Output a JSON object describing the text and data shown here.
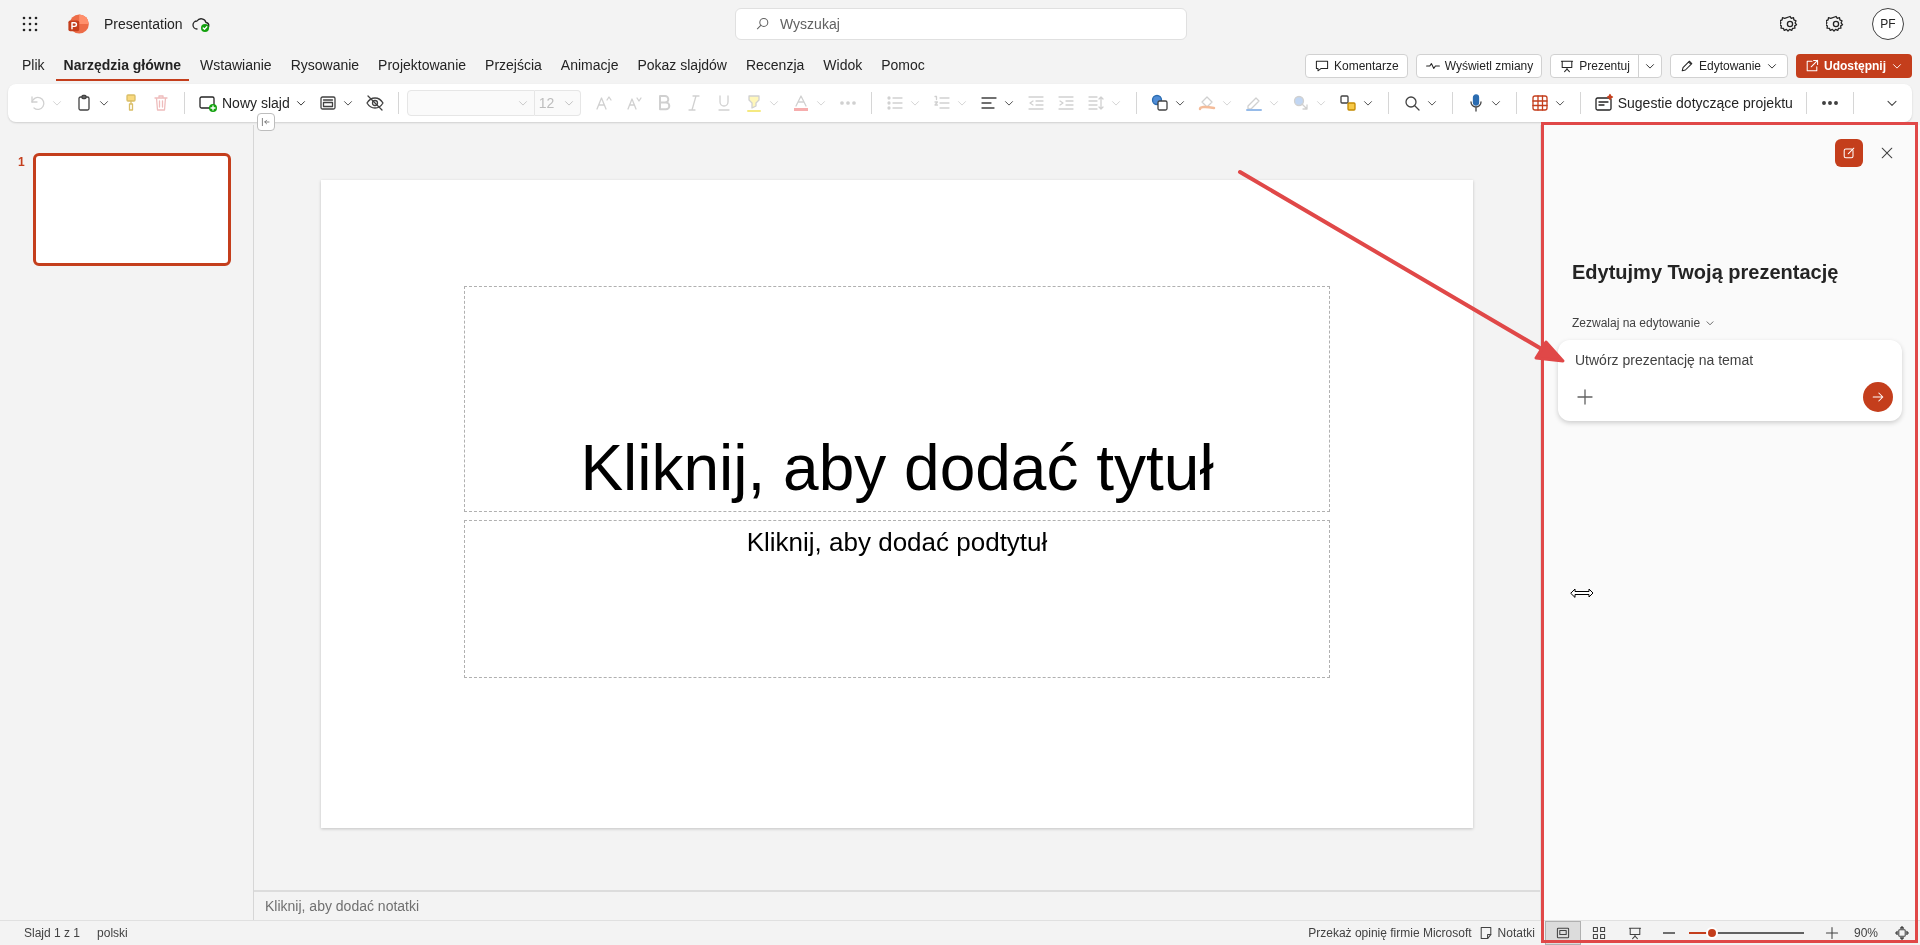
{
  "app": {
    "document_title": "Presentation",
    "search": {
      "placeholder": "Wyszukaj"
    },
    "avatar": "PF"
  },
  "tabs": [
    {
      "label": "Plik",
      "selected": false
    },
    {
      "label": "Narzędzia główne",
      "selected": true
    },
    {
      "label": "Wstawianie",
      "selected": false
    },
    {
      "label": "Rysowanie",
      "selected": false
    },
    {
      "label": "Projektowanie",
      "selected": false
    },
    {
      "label": "Przejścia",
      "selected": false
    },
    {
      "label": "Animacje",
      "selected": false
    },
    {
      "label": "Pokaz slajdów",
      "selected": false
    },
    {
      "label": "Recenzja",
      "selected": false
    },
    {
      "label": "Widok",
      "selected": false
    },
    {
      "label": "Pomoc",
      "selected": false
    }
  ],
  "header_buttons": [
    {
      "kind": "plain",
      "label": "Komentarze"
    },
    {
      "kind": "plain",
      "label": "Wyświetl zmiany"
    },
    {
      "kind": "split",
      "label": "Prezentuj"
    },
    {
      "kind": "dropdown",
      "label": "Edytowanie"
    },
    {
      "kind": "primary",
      "label": "Udostępnij"
    }
  ],
  "ribbon": {
    "groups": [
      {
        "items": [
          {
            "kind": "icon",
            "disabled": true,
            "dropdown": true
          },
          {
            "kind": "icon",
            "disabled": false,
            "dropdown": true
          },
          {
            "kind": "icon",
            "disabled": true,
            "dropdown": false
          },
          {
            "kind": "icon",
            "disabled": true,
            "dropdown": false
          }
        ]
      },
      {
        "items": [
          {
            "kind": "label",
            "label": "Nowy slajd",
            "disabled": false,
            "dropdown": true
          },
          {
            "kind": "icon",
            "disabled": false,
            "dropdown": true
          },
          {
            "kind": "icon",
            "disabled": false,
            "dropdown": false
          }
        ]
      },
      {
        "items": [
          {
            "kind": "font",
            "disabled": true
          },
          {
            "kind": "size",
            "value": "12",
            "disabled": true
          },
          {
            "kind": "icon",
            "disabled": true,
            "dropdown": false
          },
          {
            "kind": "icon",
            "disabled": true,
            "dropdown": false
          },
          {
            "kind": "icon",
            "disabled": true,
            "dropdown": false
          },
          {
            "kind": "icon",
            "disabled": true,
            "dropdown": false
          },
          {
            "kind": "icon",
            "disabled": true,
            "dropdown": false
          },
          {
            "kind": "icon",
            "disabled": true,
            "dropdown": true
          },
          {
            "kind": "icon",
            "disabled": true,
            "dropdown": true
          },
          {
            "kind": "icon",
            "disabled": true,
            "dropdown": false
          }
        ]
      },
      {
        "items": [
          {
            "kind": "icon",
            "disabled": true,
            "dropdown": true
          },
          {
            "kind": "icon",
            "disabled": true,
            "dropdown": true
          },
          {
            "kind": "icon",
            "disabled": false,
            "dropdown": true
          },
          {
            "kind": "icon",
            "disabled": true,
            "dropdown": false
          },
          {
            "kind": "icon",
            "disabled": true,
            "dropdown": false
          },
          {
            "kind": "icon",
            "disabled": true,
            "dropdown": true
          }
        ]
      },
      {
        "items": [
          {
            "kind": "icon",
            "disabled": false,
            "dropdown": true
          },
          {
            "kind": "icon",
            "disabled": true,
            "dropdown": true
          },
          {
            "kind": "icon",
            "disabled": true,
            "dropdown": true
          },
          {
            "kind": "icon",
            "disabled": true,
            "dropdown": true
          },
          {
            "kind": "icon",
            "disabled": false,
            "dropdown": true
          }
        ]
      },
      {
        "items": [
          {
            "kind": "icon",
            "disabled": false,
            "dropdown": true
          }
        ]
      },
      {
        "items": [
          {
            "kind": "icon",
            "disabled": false,
            "dropdown": true
          }
        ]
      },
      {
        "items": [
          {
            "kind": "icon",
            "disabled": false,
            "dropdown": true
          }
        ]
      },
      {
        "items": [
          {
            "kind": "label",
            "label": "Sugestie dotyczące projektu",
            "disabled": false,
            "dropdown": false
          }
        ]
      },
      {
        "items": [
          {
            "kind": "icon",
            "disabled": false,
            "dropdown": false
          }
        ]
      }
    ]
  },
  "thumbnails": [
    {
      "number": "1",
      "selected": true
    }
  ],
  "slide": {
    "title_placeholder": "Kliknij, aby dodać tytuł",
    "subtitle_placeholder": "Kliknij, aby dodać podtytuł"
  },
  "notes": {
    "placeholder": "Kliknij, aby dodać notatki"
  },
  "copilot": {
    "heading": "Edytujmy Twoją prezentację",
    "mode": "Zezwalaj na edytowanie",
    "prompt": {
      "placeholder": "Utwórz prezentację na temat"
    }
  },
  "status_bar": {
    "slide": "Slajd 1 z 1",
    "language": "polski",
    "feedback": "Przekaż opinię firmie Microsoft",
    "notes": "Notatki",
    "views": [
      {
        "selected": true
      },
      {
        "selected": false
      },
      {
        "selected": false
      }
    ],
    "zoom": {
      "level": 0.2,
      "reading": "90%"
    }
  }
}
